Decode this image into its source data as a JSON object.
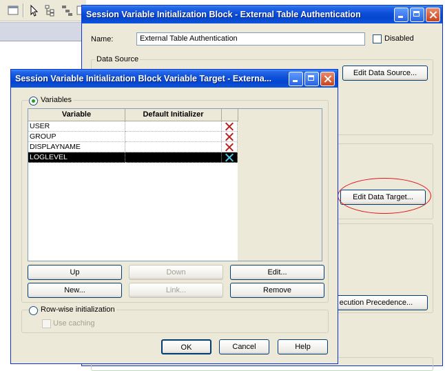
{
  "main_dialog": {
    "title": "Session Variable Initialization Block - External Table Authentication",
    "name_label": "Name:",
    "name_value": "External Table Authentication",
    "disabled_label": "Disabled",
    "data_source_group": "Data Source",
    "edit_data_source_label": "Edit Data Source...",
    "edit_data_target_label": "Edit Data Target...",
    "execution_precedence_label": "ecution Precedence..."
  },
  "target_dialog": {
    "title": "Session Variable Initialization Block Variable Target - Externa...",
    "variables_radio_label": "Variables",
    "columns": [
      "Variable",
      "Default Initializer"
    ],
    "rows": [
      {
        "variable": "USER",
        "default": ""
      },
      {
        "variable": "GROUP",
        "default": ""
      },
      {
        "variable": "DISPLAYNAME",
        "default": ""
      },
      {
        "variable": "LOGLEVEL",
        "default": "",
        "selected": true
      }
    ],
    "buttons": {
      "up": "Up",
      "down": "Down",
      "edit": "Edit...",
      "new": "New...",
      "link": "Link...",
      "remove": "Remove",
      "ok": "OK",
      "cancel": "Cancel",
      "help": "Help"
    },
    "rowwise_label": "Row-wise initialization",
    "use_caching_label": "Use caching"
  },
  "colors": {
    "annotation": "#e0171b",
    "title_bar": "#0a4fd8",
    "dialog_bg": "#ece9d8"
  }
}
